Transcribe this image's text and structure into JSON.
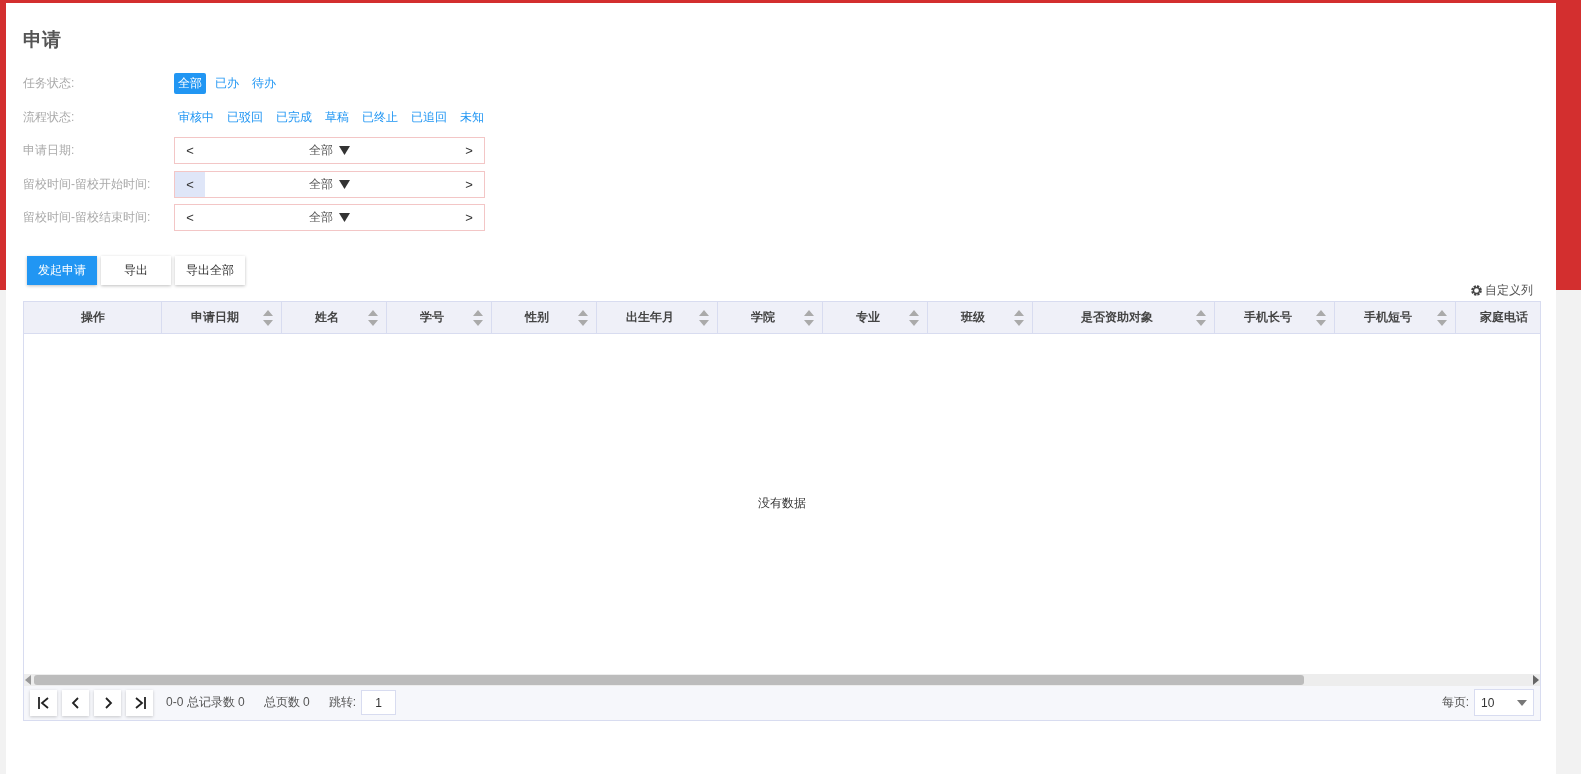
{
  "title": "申请",
  "task_status": {
    "label": "任务状态:",
    "options": [
      {
        "label": "全部",
        "selected": true
      },
      {
        "label": "已办",
        "selected": false
      },
      {
        "label": "待办",
        "selected": false
      }
    ]
  },
  "process_status": {
    "label": "流程状态:",
    "options": [
      {
        "label": "审核中",
        "selected": false
      },
      {
        "label": "已驳回",
        "selected": false
      },
      {
        "label": "已完成",
        "selected": false
      },
      {
        "label": "草稿",
        "selected": false
      },
      {
        "label": "已终止",
        "selected": false
      },
      {
        "label": "已追回",
        "selected": false
      },
      {
        "label": "未知",
        "selected": false
      }
    ]
  },
  "date_filters": [
    {
      "label": "申请日期:",
      "prev": "<",
      "value": "全部",
      "next": ">",
      "prev_hovered": false
    },
    {
      "label": "留校时间-留校开始时间:",
      "prev": "<",
      "value": "全部",
      "next": ">",
      "prev_hovered": true
    },
    {
      "label": "留校时间-留校结束时间:",
      "prev": "<",
      "value": "全部",
      "next": ">",
      "prev_hovered": false
    }
  ],
  "buttons": [
    {
      "label": "发起申请",
      "kind": "primary"
    },
    {
      "label": "导出",
      "kind": "default"
    },
    {
      "label": "导出全部",
      "kind": "default"
    }
  ],
  "customize_columns": "自定义列",
  "table": {
    "columns": [
      {
        "label": "操作",
        "sortable": false
      },
      {
        "label": "申请日期",
        "sortable": true
      },
      {
        "label": "姓名",
        "sortable": true
      },
      {
        "label": "学号",
        "sortable": true
      },
      {
        "label": "性别",
        "sortable": true
      },
      {
        "label": "出生年月",
        "sortable": true
      },
      {
        "label": "学院",
        "sortable": true
      },
      {
        "label": "专业",
        "sortable": true
      },
      {
        "label": "班级",
        "sortable": true
      },
      {
        "label": "是否资助对象",
        "sortable": true
      },
      {
        "label": "手机长号",
        "sortable": true
      },
      {
        "label": "手机短号",
        "sortable": true
      },
      {
        "label": "家庭电话"
      }
    ],
    "empty_message": "没有数据"
  },
  "pager": {
    "summary": "0-0 总记录数 0",
    "pages": "总页数 0",
    "jump_label": "跳转:",
    "jump_value": "1",
    "per_page_label": "每页:",
    "per_page_value": "10"
  }
}
